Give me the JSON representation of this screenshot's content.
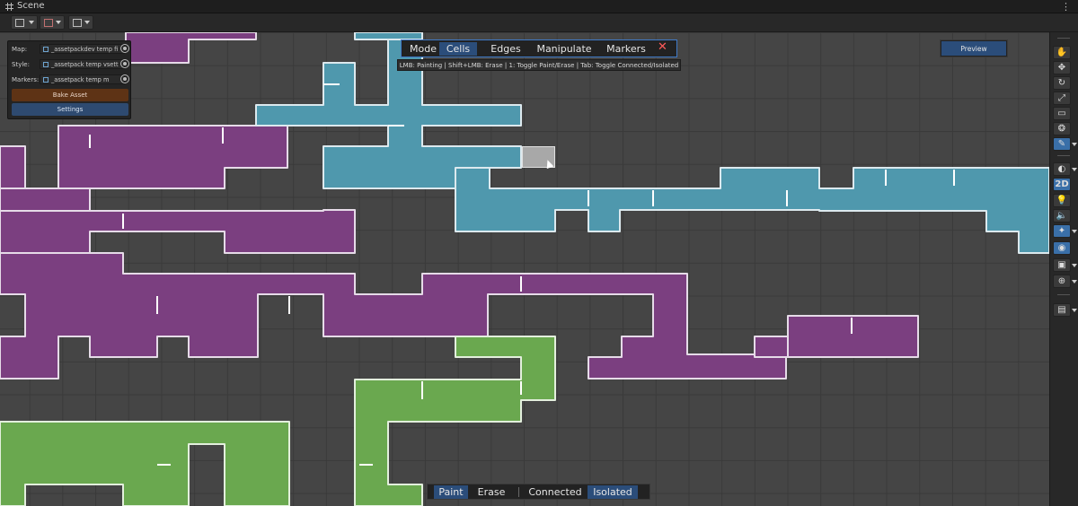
{
  "window": {
    "title": "Scene",
    "menu_icon": "kebab-menu-icon"
  },
  "toolbar": {
    "buttons": [
      "transform-tools-icon",
      "snap-icon",
      "grid-icon"
    ]
  },
  "panel": {
    "map_label": "Map:",
    "map_value": "_assetpackdev temp fi",
    "style_label": "Style:",
    "style_value": "_assetpack temp vsett",
    "markers_label": "Markers:",
    "markers_value": "_assetpack temp m",
    "bake_label": "Bake Asset",
    "settings_label": "Settings"
  },
  "modebar": {
    "mode_label": "Mode",
    "items": [
      "Cells",
      "Edges",
      "Manipulate",
      "Markers"
    ],
    "selected": "Cells",
    "close_glyph": "✕"
  },
  "hint": "LMB: Painting | Shift+LMB: Erase | 1: Toggle Paint/Erase | Tab: Toggle Connected/Isolated",
  "preview_label": "Preview",
  "bottombar": {
    "paint_label": "Paint",
    "erase_label": "Erase",
    "connected_label": "Connected",
    "isolated_label": "Isolated"
  },
  "rightbar": {
    "tools": [
      "hand-icon",
      "move-icon",
      "rotate-icon",
      "scale-icon",
      "rect-icon",
      "transform-icon",
      "brush-icon"
    ],
    "view": [
      "shading-icon",
      "2d-toggle",
      "light-icon",
      "audio-icon",
      "effects-icon",
      "visibility-icon",
      "camera-icon",
      "gizmo-icon",
      "layout-icon"
    ],
    "label_2d": "2D"
  },
  "colors": {
    "purple": "#7b3f80",
    "blue": "#4f98ad",
    "green": "#6aa84f",
    "accent": "#3f7ac8"
  }
}
